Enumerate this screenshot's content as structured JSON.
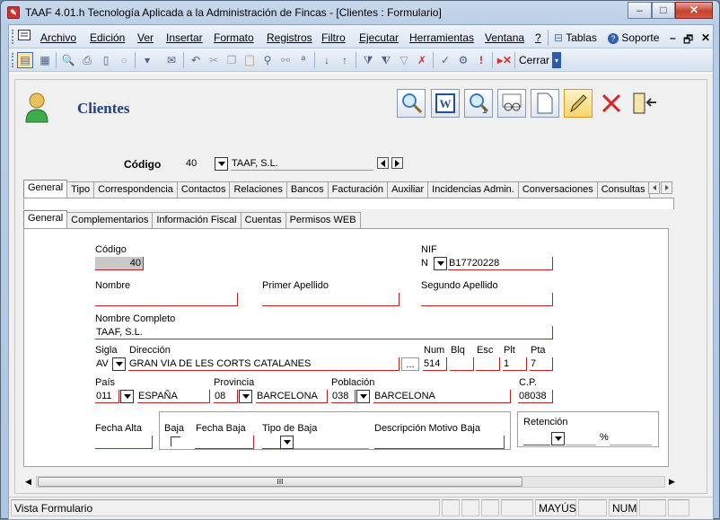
{
  "window": {
    "title": "TAAF 4.01.h Tecnología Aplicada a la Administración de Fincas - [Clientes : Formulario]"
  },
  "menu": {
    "items": [
      "Archivo",
      "Edición",
      "Ver",
      "Insertar",
      "Formato",
      "Registros",
      "Filtro",
      "Ejecutar",
      "Herramientas",
      "Ventana",
      "?"
    ],
    "tablas": "Tablas",
    "soporte": "Soporte"
  },
  "toolbar": {
    "cerrar": "Cerrar"
  },
  "form": {
    "title": "Clientes",
    "codigo_label": "Código",
    "codigo_value": "40",
    "codigo_name": "TAAF, S.L."
  },
  "main_tabs": [
    "General",
    "Tipo",
    "Correspondencia",
    "Contactos",
    "Relaciones",
    "Bancos",
    "Facturación",
    "Auxiliar",
    "Incidencias Admin.",
    "Conversaciones",
    "Consultas"
  ],
  "sub_tabs": [
    "General",
    "Complementarios",
    "Información Fiscal",
    "Cuentas",
    "Permisos WEB"
  ],
  "fields": {
    "codigo": {
      "label": "Código",
      "value": "40"
    },
    "nif": {
      "label": "NIF",
      "type": "N",
      "value": "B17720228"
    },
    "nombre": {
      "label": "Nombre",
      "value": ""
    },
    "primer_apellido": {
      "label": "Primer Apellido",
      "value": ""
    },
    "segundo_apellido": {
      "label": "Segundo Apellido",
      "value": ""
    },
    "nombre_completo": {
      "label": "Nombre Completo",
      "value": "TAAF, S.L."
    },
    "sigla": {
      "label": "Sigla",
      "value": "AV"
    },
    "direccion": {
      "label": "Dirección",
      "value": "GRAN VIA DE LES CORTS CATALANES",
      "browse": "..."
    },
    "num": {
      "label": "Num",
      "value": "514"
    },
    "blq": {
      "label": "Blq",
      "value": ""
    },
    "esc": {
      "label": "Esc",
      "value": ""
    },
    "plt": {
      "label": "Plt",
      "value": "1"
    },
    "pta": {
      "label": "Pta",
      "value": "7"
    },
    "pais": {
      "label": "País",
      "code": "011",
      "name": "ESPAÑA"
    },
    "provincia": {
      "label": "Provincia",
      "code": "08",
      "name": "BARCELONA"
    },
    "poblacion": {
      "label": "Población",
      "code": "038",
      "name": "BARCELONA"
    },
    "cp": {
      "label": "C.P.",
      "value": "08038"
    },
    "fecha_alta": {
      "label": "Fecha Alta",
      "value": ""
    },
    "baja": {
      "label": "Baja"
    },
    "fecha_baja": {
      "label": "Fecha Baja",
      "value": ""
    },
    "tipo_baja": {
      "label": "Tipo de Baja",
      "value": ""
    },
    "descripcion_baja": {
      "label": "Descripción Motivo Baja",
      "value": ""
    },
    "retencion": {
      "label": "Retención",
      "percent": "%"
    }
  },
  "scrollbar": {
    "thumb": "III"
  },
  "status": {
    "text": "Vista Formulario",
    "mayus": "MAYÚS",
    "num": "NUM"
  }
}
